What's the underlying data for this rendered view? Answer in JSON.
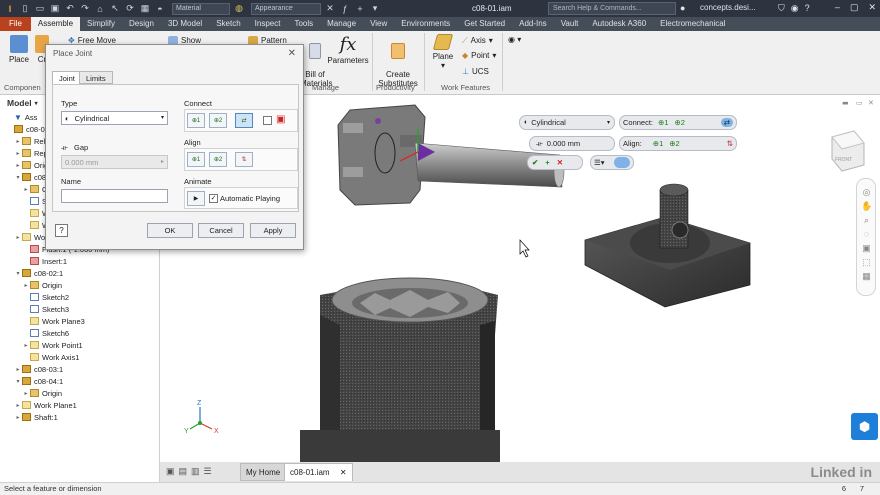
{
  "window": {
    "title": "c08-01.iam",
    "help_search": "Search Help & Commands...",
    "user": "concepts.desi...",
    "qa_combo_1": "Material",
    "qa_combo_2": "Appearance"
  },
  "tabs": [
    "File",
    "Assemble",
    "Simplify",
    "Design",
    "3D Model",
    "Sketch",
    "Inspect",
    "Tools",
    "Manage",
    "View",
    "Environments",
    "Get Started",
    "Add-Ins",
    "Vault",
    "Autodesk A360",
    "Electromechanical"
  ],
  "active_tab": "Assemble",
  "ribbon": {
    "place": "Place",
    "create_abbr": "Cr",
    "free_move": "Free Move",
    "show": "Show",
    "pattern": "Pattern",
    "bill_of_materials": "Bill of\nMaterials",
    "parameters": "Parameters",
    "create_substitutes": "Create\nSubstitutes",
    "plane": "Plane",
    "axis": "Axis",
    "point": "Point",
    "ucs": "UCS",
    "panel_component": "Componen",
    "panel_manage": "Manage",
    "panel_productivity": "Productivity",
    "panel_work_features": "Work Features"
  },
  "browser": {
    "header": "Model",
    "items": [
      {
        "label": "Ass",
        "depth": 0,
        "toggle": "",
        "icon": "filter"
      },
      {
        "label": "c08-0",
        "depth": 0,
        "toggle": "",
        "icon": "part"
      },
      {
        "label": "Relat",
        "depth": 1,
        "toggle": "▸",
        "icon": "folder"
      },
      {
        "label": "Repre",
        "depth": 1,
        "toggle": "▸",
        "icon": "folder"
      },
      {
        "label": "Origi",
        "depth": 1,
        "toggle": "▸",
        "icon": "folder"
      },
      {
        "label": "c08-0",
        "depth": 1,
        "toggle": "▾",
        "icon": "part"
      },
      {
        "label": "Origi",
        "depth": 2,
        "toggle": "▸",
        "icon": "folder"
      },
      {
        "label": "Sketc",
        "depth": 2,
        "toggle": "",
        "icon": "sketch"
      },
      {
        "label": "Work",
        "depth": 2,
        "toggle": "",
        "icon": "plane"
      },
      {
        "label": "Work",
        "depth": 2,
        "toggle": "",
        "icon": "plane"
      },
      {
        "label": "Work Plane3",
        "depth": 1,
        "toggle": "▸",
        "icon": "plane"
      },
      {
        "label": "Flush:1 (-1.000 mm)",
        "depth": 2,
        "toggle": "",
        "icon": "red"
      },
      {
        "label": "Insert:1",
        "depth": 2,
        "toggle": "",
        "icon": "red"
      },
      {
        "label": "c08-02:1",
        "depth": 1,
        "toggle": "▾",
        "icon": "part"
      },
      {
        "label": "Origin",
        "depth": 2,
        "toggle": "▸",
        "icon": "folder"
      },
      {
        "label": "Sketch2",
        "depth": 2,
        "toggle": "",
        "icon": "sketch"
      },
      {
        "label": "Sketch3",
        "depth": 2,
        "toggle": "",
        "icon": "sketch"
      },
      {
        "label": "Work Plane3",
        "depth": 2,
        "toggle": "",
        "icon": "plane"
      },
      {
        "label": "Sketch6",
        "depth": 2,
        "toggle": "",
        "icon": "sketch"
      },
      {
        "label": "Work Point1",
        "depth": 2,
        "toggle": "▸",
        "icon": "plane"
      },
      {
        "label": "Work Axis1",
        "depth": 2,
        "toggle": "",
        "icon": "plane"
      },
      {
        "label": "c08-03:1",
        "depth": 1,
        "toggle": "▸",
        "icon": "part"
      },
      {
        "label": "c08-04:1",
        "depth": 1,
        "toggle": "▾",
        "icon": "part"
      },
      {
        "label": "Origin",
        "depth": 2,
        "toggle": "▸",
        "icon": "folder"
      },
      {
        "label": "Work Plane1",
        "depth": 1,
        "toggle": "▸",
        "icon": "plane"
      },
      {
        "label": "Shaft:1",
        "depth": 1,
        "toggle": "▸",
        "icon": "part"
      }
    ]
  },
  "dialog": {
    "title": "Place Joint",
    "tab_joint": "Joint",
    "tab_limits": "Limits",
    "type_label": "Type",
    "type_value": "Cylindrical",
    "gap_label": "Gap",
    "gap_value": "0.000 mm",
    "name_label": "Name",
    "name_value": "",
    "connect_label": "Connect",
    "align_label": "Align",
    "animate_label": "Animate",
    "auto_playing": "Automatic Playing",
    "auto_checked": true,
    "btn_1": "1",
    "btn_2": "2",
    "ok": "OK",
    "cancel": "Cancel",
    "apply": "Apply"
  },
  "mini_toolbar": {
    "type_value": "Cylindrical",
    "connect_label": "Connect:",
    "align_label": "Align:",
    "gap_value": "0.000 mm",
    "n1": "1",
    "n2": "2"
  },
  "viewcube": {
    "face": "FRONT"
  },
  "doc_tabs": {
    "home": "My Home",
    "active": "c08-01.iam"
  },
  "status": {
    "text": "Select a feature or dimension",
    "count_a": "6",
    "count_b": "7"
  },
  "watermark": "Linked in",
  "colors": {
    "file_tab": "#b8421e",
    "title_bar": "#2d3440",
    "tab_bar": "#454d59",
    "ribbon": "#f0f0f0",
    "accent": "#1d7fd8"
  }
}
